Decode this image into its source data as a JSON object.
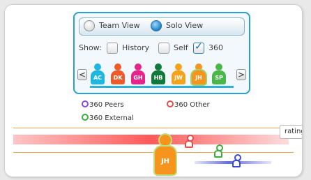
{
  "view_toggle": {
    "team_label": "Team View",
    "solo_label": "Solo View",
    "selected": "solo"
  },
  "show": {
    "label": "Show:",
    "history_label": "History",
    "self_label": "Self",
    "360_label": "360",
    "history_checked": false,
    "self_checked": false,
    "360_checked": true
  },
  "nav": {
    "prev": "<",
    "next": ">"
  },
  "people": [
    {
      "initials": "AC",
      "color": "#1fb7e1"
    },
    {
      "initials": "DK",
      "color": "#f05a2a"
    },
    {
      "initials": "GH",
      "color": "#e8238e"
    },
    {
      "initials": "HB",
      "color": "#0f7a3a"
    },
    {
      "initials": "JW",
      "color": "#f7a21b"
    },
    {
      "initials": "JH",
      "color": "#f7941d",
      "selected": true
    },
    {
      "initials": "SP",
      "color": "#49b848"
    }
  ],
  "legend": {
    "peers": {
      "label": "360 Peers",
      "color": "#8a4bd6"
    },
    "other": {
      "label": "360 Other",
      "color": "#e84c4c"
    },
    "external": {
      "label": "360 External",
      "color": "#3bab3b"
    }
  },
  "rating_label": "rating",
  "focus_person": {
    "initials": "JH",
    "color": "#f7941d"
  },
  "markers": {
    "other": "#e84c4c",
    "external": "#3bab3b",
    "peers": "#3b46d6"
  }
}
